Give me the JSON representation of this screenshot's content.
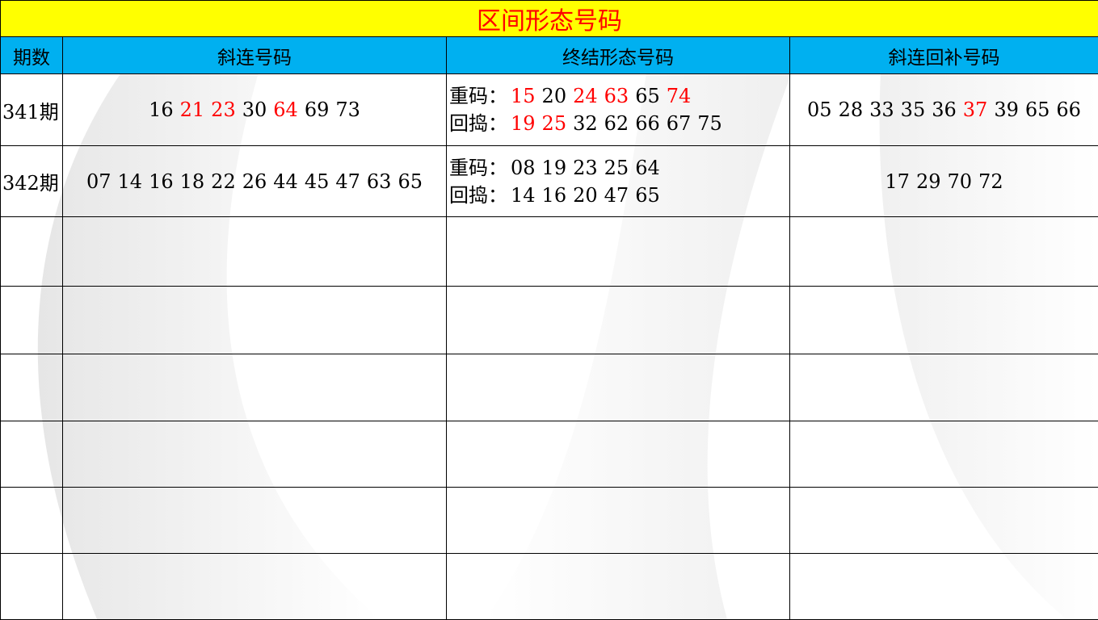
{
  "title": "区间形态号码",
  "headers": [
    "期数",
    "斜连号码",
    "终结形态号码",
    "斜连回补号码"
  ],
  "colors": {
    "title_bg": "#ffff00",
    "title_text": "#ff0000",
    "header_bg": "#00b0f0",
    "highlight": "#ff0000"
  },
  "rows": [
    {
      "period": "341期",
      "xielian": [
        {
          "n": "16",
          "red": false
        },
        {
          "n": "21",
          "red": true
        },
        {
          "n": "23",
          "red": true
        },
        {
          "n": "30",
          "red": false
        },
        {
          "n": "64",
          "red": true
        },
        {
          "n": "69",
          "red": false
        },
        {
          "n": "73",
          "red": false
        }
      ],
      "zhongma_label": "重码：",
      "zhongma": [
        {
          "n": "15",
          "red": true
        },
        {
          "n": "20",
          "red": false
        },
        {
          "n": "24",
          "red": true
        },
        {
          "n": "63",
          "red": true
        },
        {
          "n": "65",
          "red": false
        },
        {
          "n": "74",
          "red": true
        }
      ],
      "huidao_label": "回捣：",
      "huidao": [
        {
          "n": "19",
          "red": true
        },
        {
          "n": "25",
          "red": true
        },
        {
          "n": "32",
          "red": false
        },
        {
          "n": "62",
          "red": false
        },
        {
          "n": "66",
          "red": false
        },
        {
          "n": "67",
          "red": false
        },
        {
          "n": "75",
          "red": false
        }
      ],
      "huibu": [
        {
          "n": "05",
          "red": false
        },
        {
          "n": "28",
          "red": false
        },
        {
          "n": "33",
          "red": false
        },
        {
          "n": "35",
          "red": false
        },
        {
          "n": "36",
          "red": false
        },
        {
          "n": "37",
          "red": true
        },
        {
          "n": "39",
          "red": false
        },
        {
          "n": "65",
          "red": false
        },
        {
          "n": "66",
          "red": false
        }
      ]
    },
    {
      "period": "342期",
      "xielian": [
        {
          "n": "07",
          "red": false
        },
        {
          "n": "14",
          "red": false
        },
        {
          "n": "16",
          "red": false
        },
        {
          "n": "18",
          "red": false
        },
        {
          "n": "22",
          "red": false
        },
        {
          "n": "26",
          "red": false
        },
        {
          "n": "44",
          "red": false
        },
        {
          "n": "45",
          "red": false
        },
        {
          "n": "47",
          "red": false
        },
        {
          "n": "63",
          "red": false
        },
        {
          "n": "65",
          "red": false
        }
      ],
      "zhongma_label": "重码：",
      "zhongma": [
        {
          "n": "08",
          "red": false
        },
        {
          "n": "19",
          "red": false
        },
        {
          "n": "23",
          "red": false
        },
        {
          "n": "25",
          "red": false
        },
        {
          "n": "64",
          "red": false
        }
      ],
      "huidao_label": "回捣：",
      "huidao": [
        {
          "n": "14",
          "red": false
        },
        {
          "n": "16",
          "red": false
        },
        {
          "n": "20",
          "red": false
        },
        {
          "n": "47",
          "red": false
        },
        {
          "n": "65",
          "red": false
        }
      ],
      "huibu": [
        {
          "n": "17",
          "red": false
        },
        {
          "n": "29",
          "red": false
        },
        {
          "n": "70",
          "red": false
        },
        {
          "n": "72",
          "red": false
        }
      ]
    }
  ]
}
